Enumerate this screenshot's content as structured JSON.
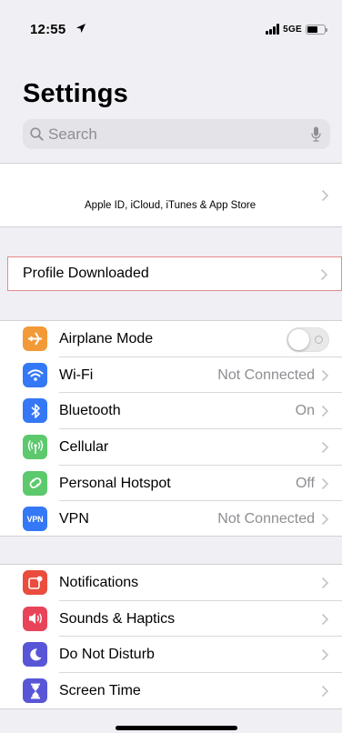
{
  "status_bar": {
    "time": "12:55",
    "network": "5GE"
  },
  "header": {
    "title": "Settings"
  },
  "search": {
    "placeholder": "Search"
  },
  "apple_id": {
    "subtitle": "Apple ID, iCloud, iTunes & App Store"
  },
  "profile": {
    "label": "Profile Downloaded"
  },
  "connectivity": [
    {
      "label": "Airplane Mode",
      "value": "",
      "icon": "airplane-icon",
      "color": "#f29a38"
    },
    {
      "label": "Wi-Fi",
      "value": "Not Connected",
      "icon": "wifi-icon",
      "color": "#3478f6"
    },
    {
      "label": "Bluetooth",
      "value": "On",
      "icon": "bluetooth-icon",
      "color": "#3478f6"
    },
    {
      "label": "Cellular",
      "value": "",
      "icon": "cellular-icon",
      "color": "#5cc96c"
    },
    {
      "label": "Personal Hotspot",
      "value": "Off",
      "icon": "hotspot-icon",
      "color": "#5cc96c"
    },
    {
      "label": "VPN",
      "value": "Not Connected",
      "icon": "vpn-icon",
      "icon_text": "VPN",
      "color": "#3478f6"
    }
  ],
  "general": [
    {
      "label": "Notifications",
      "icon": "notifications-icon",
      "color": "#ea4c3e"
    },
    {
      "label": "Sounds & Haptics",
      "icon": "sounds-icon",
      "color": "#e94359"
    },
    {
      "label": "Do Not Disturb",
      "icon": "moon-icon",
      "color": "#5856d6"
    },
    {
      "label": "Screen Time",
      "icon": "hourglass-icon",
      "color": "#5856d6"
    }
  ],
  "toggles": {
    "airplane_mode": "off"
  }
}
